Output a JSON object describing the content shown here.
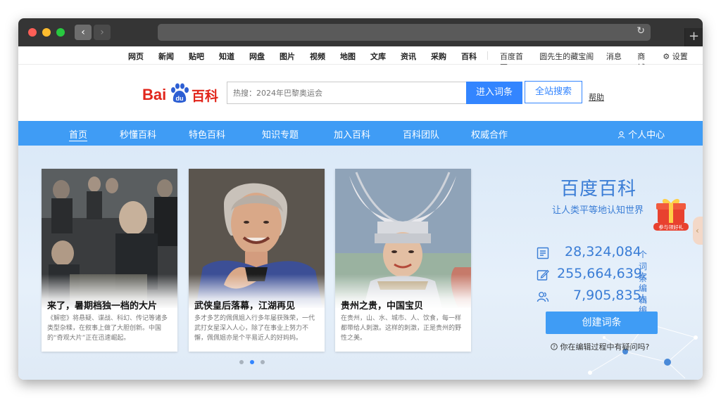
{
  "browser": {
    "back_icon": "chevron-left-icon",
    "forward_icon": "chevron-right-icon",
    "reload_icon": "reload-icon",
    "newtab_label": "+"
  },
  "topnav": {
    "left": [
      "网页",
      "新闻",
      "贴吧",
      "知道",
      "网盘",
      "图片",
      "视频",
      "地图",
      "文库",
      "资讯",
      "采购",
      "百科"
    ],
    "right": [
      "百度首页",
      "圆先生的藏宝阁 ▾",
      "消息 ▾",
      "商城",
      "⚙ 设置 ▾"
    ]
  },
  "logo": {
    "bai": "Bai",
    "du": "du",
    "baike": "百科"
  },
  "search": {
    "placeholder": "热搜：2024年巴黎奥运会",
    "enter_label": "进入词条",
    "all_label": "全站搜索",
    "help_label": "帮助"
  },
  "bluenav": {
    "items": [
      "首页",
      "秒懂百科",
      "特色百科",
      "知识专题",
      "加入百科",
      "百科团队",
      "权威合作"
    ],
    "user_center": "个人中心"
  },
  "cards": [
    {
      "title": "来了，暑期档独一档的大片",
      "desc": "《解密》将悬疑、谍战、科幻、传记等诸多类型杂糅，在叙事上做了大胆创新。中国的“奇观大片”正在迅速崛起。"
    },
    {
      "title": "武侠皇后落幕，江湖再见",
      "desc": "多才多艺的佩佩姐入行多年屡获殊荣，一代武打女星深入人心，除了在事业上努力不懈，佩佩姐亦是个平易近人的好妈妈。"
    },
    {
      "title": "贵州之贵，中国宝贝",
      "desc": "在贵州，山、水、城市、人、饮食，每一样都带给人刺激。这样的刺激，正是贵州的野性之美。"
    }
  ],
  "carousel": {
    "active_index": 2,
    "total": 3
  },
  "panel": {
    "title": "百度百科",
    "slogan": "让人类平等地认知世界",
    "gift_label": "参与领好礼",
    "stats": [
      {
        "icon": "list-icon",
        "num": "28,324,084",
        "unit": "个词条"
      },
      {
        "icon": "edit-icon",
        "num": "255,664,639",
        "unit": "次编辑"
      },
      {
        "icon": "users-icon",
        "num": "7,905,835",
        "unit": "人编写"
      }
    ],
    "create_label": "创建词条",
    "faq": "你在编辑过程中有疑问吗?",
    "sidetab": "‹"
  },
  "colors": {
    "brand_red": "#e1251b",
    "accent_blue": "#3385ff",
    "nav_blue": "#3f9cf5",
    "stat_blue": "#3a7dd6"
  }
}
